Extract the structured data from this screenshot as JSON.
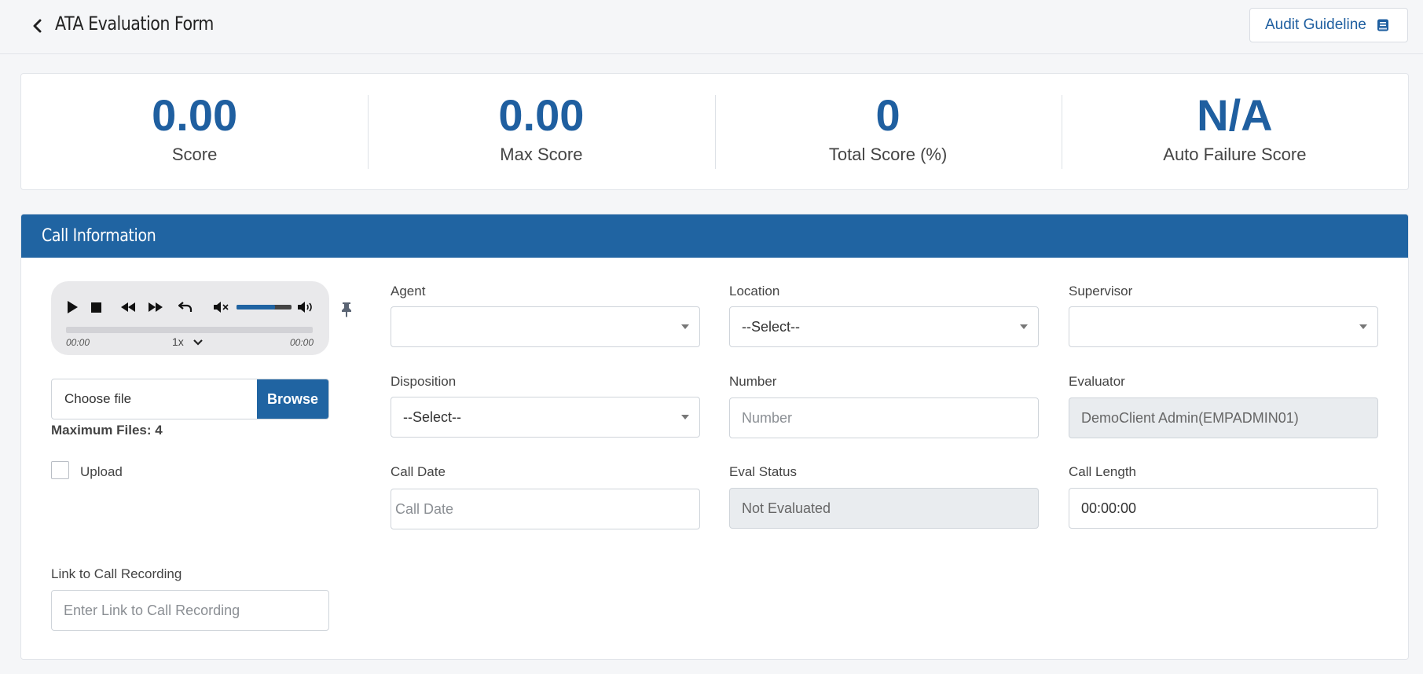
{
  "header": {
    "title": "ATA Evaluation Form",
    "guide_label": "Audit Guideline"
  },
  "scores": [
    {
      "value": "0.00",
      "label": "Score"
    },
    {
      "value": "0.00",
      "label": "Max Score"
    },
    {
      "value": "0",
      "label": "Total Score (%)"
    },
    {
      "value": "N/A",
      "label": "Auto Failure Score"
    }
  ],
  "panel": {
    "title": "Call Information"
  },
  "player": {
    "current_time": "00:00",
    "duration": "00:00",
    "speed": "1x",
    "volume_fraction": 0.7,
    "progress_fraction": 0
  },
  "files": {
    "choose_label": "Choose file",
    "browse_label": "Browse",
    "max_files": "Maximum Files: 4",
    "upload_label": "Upload",
    "upload_checked": false
  },
  "fields": {
    "agent": {
      "label": "Agent",
      "value": ""
    },
    "location": {
      "label": "Location",
      "value": "--Select--"
    },
    "supervisor": {
      "label": "Supervisor",
      "value": ""
    },
    "disposition": {
      "label": "Disposition",
      "value": "--Select--"
    },
    "number": {
      "label": "Number",
      "placeholder": "Number"
    },
    "evaluator": {
      "label": "Evaluator",
      "value": "DemoClient Admin(EMPADMIN01)"
    },
    "call_date": {
      "label": "Call Date",
      "placeholder": "Call Date"
    },
    "eval_status": {
      "label": "Eval Status",
      "value": "Not Evaluated"
    },
    "call_length": {
      "label": "Call Length",
      "value": "00:00:00"
    },
    "link": {
      "label": "Link to Call Recording",
      "placeholder": "Enter Link to Call Recording"
    }
  },
  "colors": {
    "accent": "#2064a2",
    "score_value": "#1f5fa0",
    "disabled_bg": "#e9ecef"
  }
}
